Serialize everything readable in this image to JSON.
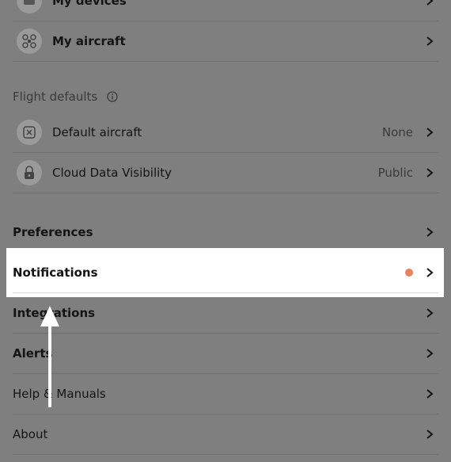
{
  "rows": {
    "my_devices": {
      "label": "My devices"
    },
    "my_aircraft": {
      "label": "My aircraft"
    },
    "flight_defaults": {
      "title": "Flight defaults"
    },
    "default_aircraft": {
      "label": "Default aircraft",
      "value": "None"
    },
    "cloud_visibility": {
      "label": "Cloud Data Visibility",
      "value": "Public"
    },
    "preferences": {
      "label": "Preferences"
    },
    "notifications": {
      "label": "Notifications",
      "badge_color": "#e8825e"
    },
    "integrations": {
      "label": "Integrations"
    },
    "alerts": {
      "label": "Alerts"
    },
    "help": {
      "label": "Help & Manuals"
    },
    "about": {
      "label": "About"
    }
  },
  "icons": [
    "device-icon",
    "aircraft-icon",
    "info-icon",
    "default-aircraft-icon",
    "lock-icon",
    "chevron-right-icon",
    "arrow-up-icon"
  ]
}
